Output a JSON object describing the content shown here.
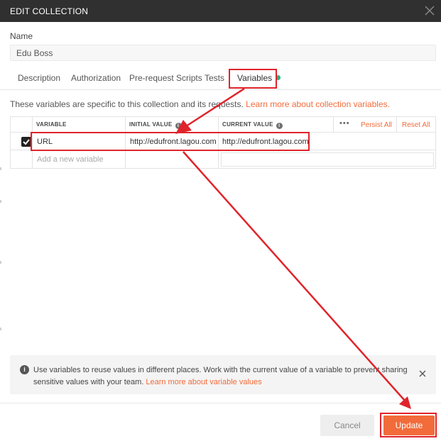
{
  "header": {
    "title": "EDIT COLLECTION",
    "close_icon": "close-icon"
  },
  "name": {
    "label": "Name",
    "value": "Edu Boss"
  },
  "tabs": [
    {
      "label": "Description",
      "active": false
    },
    {
      "label": "Authorization",
      "active": false
    },
    {
      "label": "Pre-request Scripts",
      "active": false
    },
    {
      "label": "Tests",
      "active": false
    },
    {
      "label": "Variables",
      "active": true,
      "indicator_color": "#26b47f"
    }
  ],
  "variables": {
    "info_prefix": "These variables are specific to this collection and its requests.",
    "info_link": "Learn more about collection variables.",
    "columns": {
      "variable": "VARIABLE",
      "initial_value": "INITIAL VALUE",
      "current_value": "CURRENT VALUE"
    },
    "actions": {
      "more": "•••",
      "persist_all": "Persist All",
      "reset_all": "Reset All"
    },
    "rows": [
      {
        "checked": true,
        "variable": "URL",
        "initial_value": "http://edufront.lagou.com",
        "current_value": "http://edufront.lagou.com"
      }
    ],
    "new_row_placeholder": "Add a new variable"
  },
  "notice": {
    "text": "Use variables to reuse values in different places. Work with the current value of a variable to prevent sharing sensitive values with your team.",
    "link": "Learn more about variable values"
  },
  "footer": {
    "cancel_label": "Cancel",
    "update_label": "Update"
  },
  "colors": {
    "accent": "#f26b3a",
    "header_bg": "#303030",
    "annotation_red": "#e0242b",
    "active_dot": "#26b47f"
  }
}
